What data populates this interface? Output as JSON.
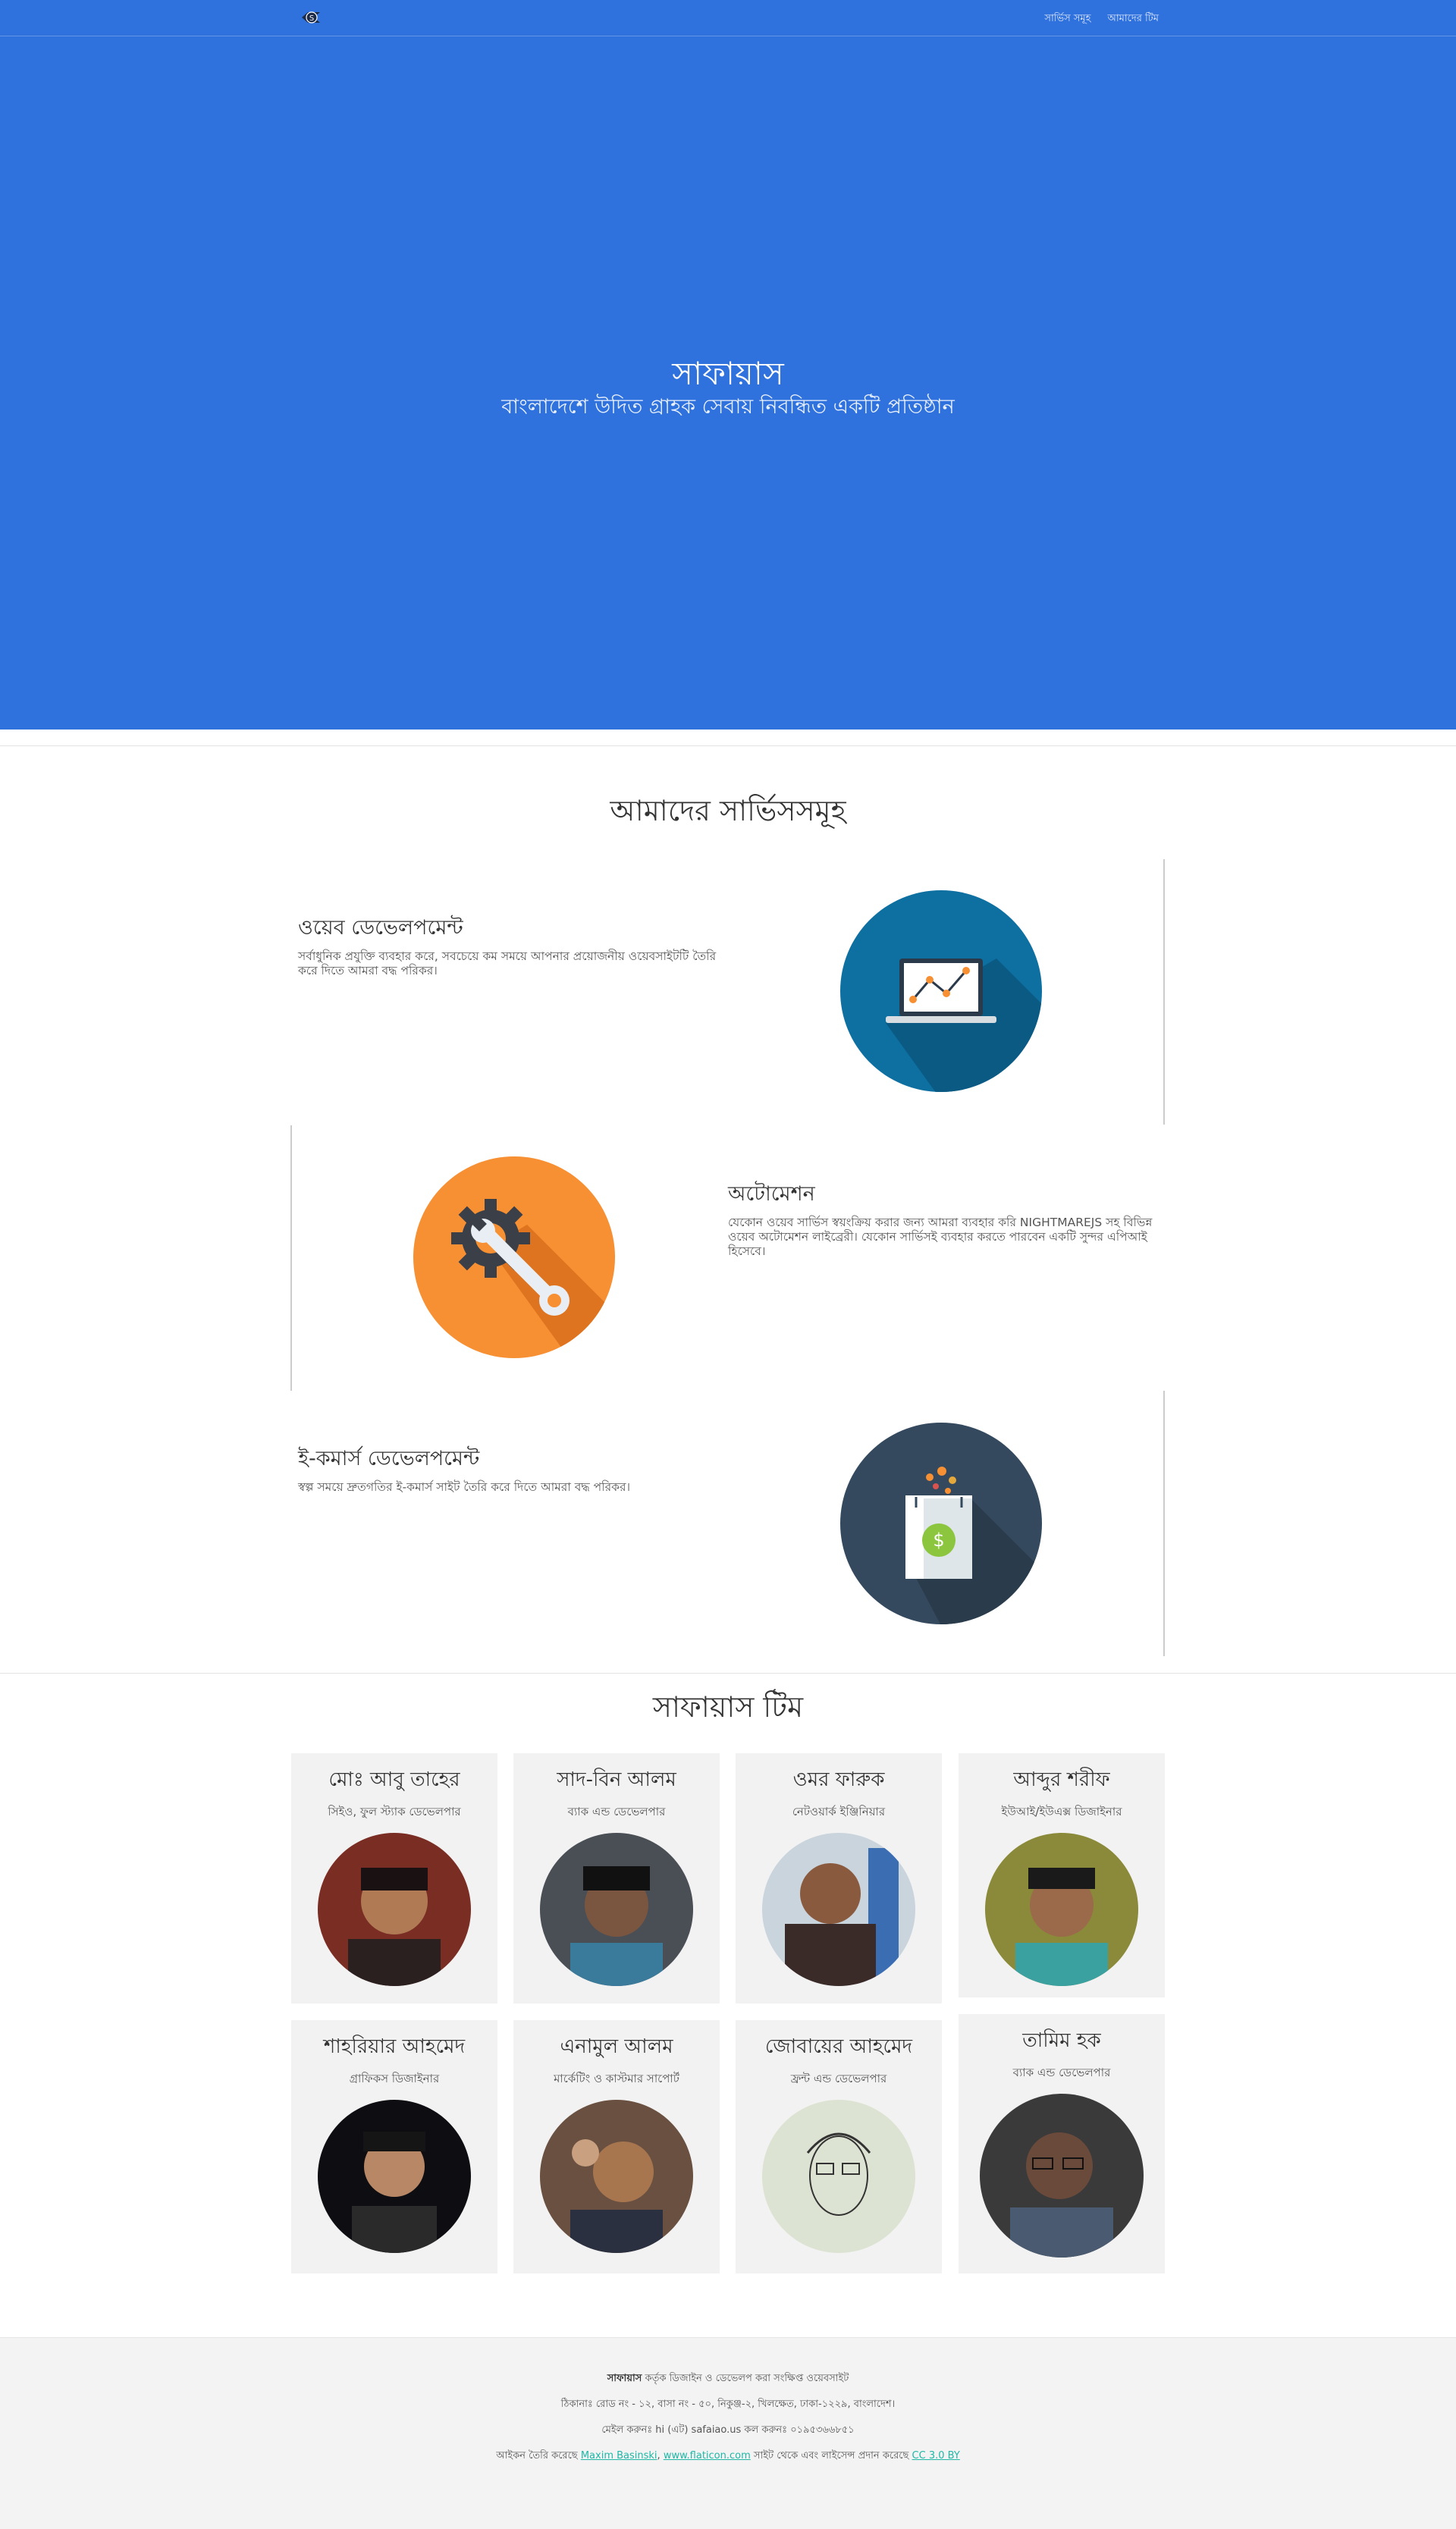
{
  "nav": {
    "logo_char": "S",
    "links": [
      "সার্ভিস সমূহ",
      "আমাদের টিম"
    ]
  },
  "hero": {
    "title": "সাফায়াস",
    "subtitle": "বাংলাদেশে উদিত গ্রাহক সেবায় নিবন্ধিত একটি প্রতিষ্ঠান",
    "background_color": "#3072dd"
  },
  "services": {
    "title": "আমাদের সার্ভিসসমূহ",
    "items": [
      {
        "title": "ওয়েব ডেভেলপমেন্ট",
        "description": "সর্বাধুনিক প্রযুক্তি ব্যবহার করে, সবচেয়ে কম সময়ে আপনার প্রয়োজনীয় ওয়েবসাইটটি তৈরি করে দিতে আমরা বদ্ধ পরিকর।",
        "icon": "web-analytics-laptop-icon",
        "icon_color": "#0e6fa1"
      },
      {
        "title": "অটোমেশন",
        "description": "যেকোন ওয়েব সার্ভিস স্বয়ংক্রিয় করার জন্য আমরা ব্যবহার করি NIGHTMAREJS সহ বিভিন্ন ওয়েব অটোমেশন লাইব্রেরী। যেকোন সার্ভিসই ব্যবহার করতে পারবেন একটি সুন্দর এপিআই হিসেবে।",
        "icon": "gear-wrench-icon",
        "icon_color": "#f78f33"
      },
      {
        "title": "ই-কমার্স ডেভেলপমেন্ট",
        "description": "স্বল্প সময়ে দ্রুতগতির ই-কমার্স সাইট তৈরি করে দিতে আমরা বদ্ধ পরিকর।",
        "icon": "shopping-bag-dollar-icon",
        "icon_color": "#34495e"
      }
    ]
  },
  "team": {
    "title": "সাফায়াস টিম",
    "members": [
      {
        "name": "মোঃ আবু তাহের",
        "role": "সিইও, ফুল স্ট্যাক ডেভেলপার"
      },
      {
        "name": "সাদ-বিন আলম",
        "role": "ব্যাক এন্ড ডেভেলপার"
      },
      {
        "name": "ওমর ফারুক",
        "role": "নেটওয়ার্ক ইঞ্জিনিয়ার"
      },
      {
        "name": "আব্দুর শরীফ",
        "role": "ইউআই/ইউএক্স ডিজাইনার"
      },
      {
        "name": "শাহরিয়ার আহমেদ",
        "role": "গ্রাফিকস ডিজাইনার"
      },
      {
        "name": "এনামুল আলম",
        "role": "মার্কেটিং ও কাস্টমার সাপোর্ট"
      },
      {
        "name": "জোবায়ের আহমেদ",
        "role": "ফ্রন্ট এন্ড ডেভেলপার"
      },
      {
        "name": "তামিম হক",
        "role": "ব্যাক এন্ড ডেভেলপার"
      }
    ]
  },
  "footer": {
    "brand": "সাফায়াস",
    "line1_rest": " কর্তৃক ডিজাইন ও ডেভেলপ করা সংক্ষিপ্ত ওয়েবসাইট",
    "address": "ঠিকানাঃ রোড নং - ১২, বাসা নং - ৫০, নিকুঞ্জ-২, খিলক্ষেত, ঢাকা-১২২৯, বাংলাদেশ।",
    "contact": "মেইল করুনঃ hi (এট) safaiao.us কল করুনঃ ০১৯৫৩৬৬৮৫১",
    "credit_prefix": "আইকন তৈরি করেছে",
    "credit_author": "Maxim Basinski",
    "credit_site": "www.flaticon.com",
    "credit_mid": "সাইট থেকে এবং লাইসেন্স প্রদান করেছে",
    "credit_license": "CC 3.0 BY"
  }
}
